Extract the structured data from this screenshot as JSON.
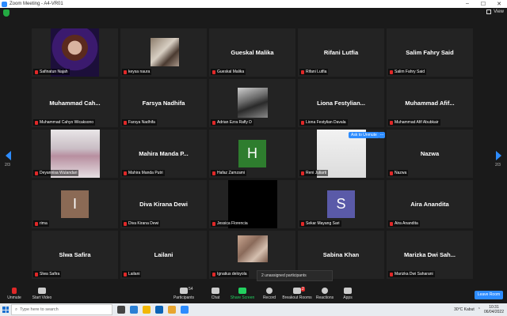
{
  "window": {
    "title": "Zoom Meeting - A4-VR01"
  },
  "top": {
    "view_label": "View"
  },
  "pager": {
    "left": "2/3",
    "right": "2/3"
  },
  "colors": {
    "accent": "#2d8cff",
    "mute_red": "#e02828",
    "green": "#23d160",
    "brown_avatar": "#8b6a55",
    "green_avatar": "#2e7d2e",
    "purple_avatar": "#5a5aa8"
  },
  "tiles": [
    {
      "name": "Safinatun Najah",
      "video": "photo-purple"
    },
    {
      "name": "keysa naura",
      "video": "photo-room"
    },
    {
      "name": "Gueskal Malika",
      "big": "Gueskal Malika"
    },
    {
      "name": "Rifani Lutfia",
      "big": "Rifani Lutfia"
    },
    {
      "name": "Salim Fahry Said",
      "big": "Salim Fahry Said"
    },
    {
      "name": "Muhammad Cahyo Wicaksono",
      "big": "Muhammad  Cah..."
    },
    {
      "name": "Farsya Nadhifa",
      "big": "Farsya Nadhifa"
    },
    {
      "name": "Adrian Ezra Rafly D",
      "video": "photo-gray"
    },
    {
      "name": "Liona Festylian Davala",
      "big": "Liona  Festylian..."
    },
    {
      "name": "Muhammad Afif Abubkair",
      "big": "Muhammad  Afif..."
    },
    {
      "name": "Deyannisa Wulandari",
      "video": "photo-hijab"
    },
    {
      "name": "Mahira Manda Putri",
      "big": "Mahira  Manda  P..."
    },
    {
      "name": "Hafaz Zamzami",
      "initial": "H"
    },
    {
      "name": "Reni Juliarti",
      "video": "photo-white"
    },
    {
      "name": "Nazwa",
      "big": "Nazwa"
    },
    {
      "name": "rima",
      "initial": "I"
    },
    {
      "name": "Diva Kirana Dewi",
      "big": "Diva Kirana Dewi"
    },
    {
      "name": "Jessica Florencia",
      "video": "photo-black"
    },
    {
      "name": "Sekar Mayang Sari",
      "initial": "S"
    },
    {
      "name": "Aira Anandita",
      "big": "Aira Anandita"
    },
    {
      "name": "Slwa Safira",
      "big": "Slwa Safira"
    },
    {
      "name": "Lailani",
      "big": "Lailani"
    },
    {
      "name": "Ignatius deloyola",
      "video": "photo-desk"
    },
    {
      "name": "",
      "big": "Sabina Khan"
    },
    {
      "name": "Marizka Dwi Saharani",
      "big": "Marizka  Dwi  Sah..."
    }
  ],
  "overlay": {
    "ask_unmute": "Ask to Unmute",
    "more": "...",
    "unassigned": "2 unassigned participants"
  },
  "toolbar": {
    "unmute": "Unmute",
    "start_video": "Start Video",
    "participants": "Participants",
    "participants_count": "54",
    "chat": "Chat",
    "share_screen": "Share Screen",
    "record": "Record",
    "breakout": "Breakout Rooms",
    "breakout_badge": "2",
    "reactions": "Reactions",
    "apps": "Apps",
    "leave": "Leave Room"
  },
  "taskbar": {
    "search_placeholder": "Type here to search",
    "weather": "30°C  Kabut",
    "time": "10:31",
    "date": "06/04/2022"
  }
}
